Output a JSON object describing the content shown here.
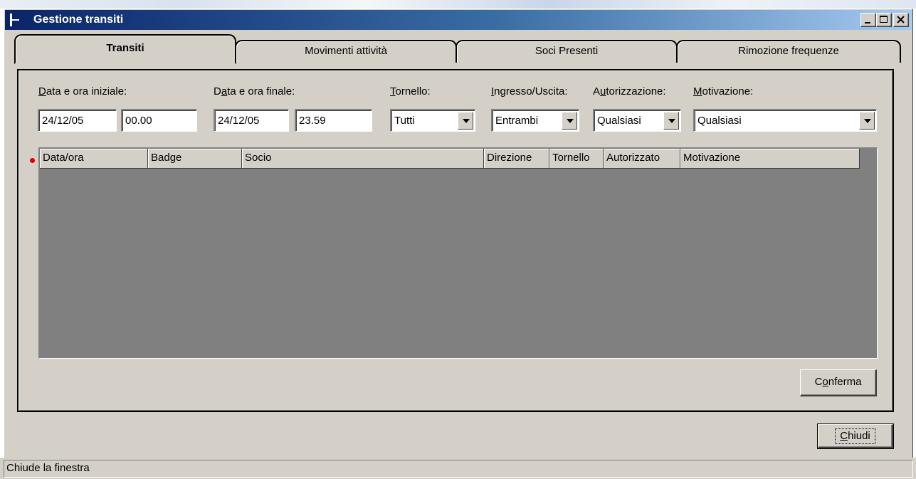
{
  "window": {
    "title": "Gestione transiti",
    "controls": {
      "minimize": "minimize-icon",
      "maximize": "maximize-icon",
      "close": "close-icon"
    }
  },
  "tabs": [
    {
      "label": "Transiti",
      "active": true
    },
    {
      "label": "Movimenti attività",
      "active": false
    },
    {
      "label": "Soci Presenti",
      "active": false
    },
    {
      "label": "Rimozione frequenze",
      "active": false
    }
  ],
  "filters": {
    "start": {
      "label_accel": "D",
      "label_rest": "ata e ora iniziale:",
      "date": "24/12/05",
      "time": "00.00"
    },
    "end": {
      "label_pre": "D",
      "label_accel": "a",
      "label_rest": "ta e ora finale:",
      "date": "24/12/05",
      "time": "23.59"
    },
    "turnstile": {
      "label_accel": "T",
      "label_rest": "ornello:",
      "value": "Tutti"
    },
    "direction": {
      "label_accel": "I",
      "label_rest": "ngresso/Uscita:",
      "value": "Entrambi"
    },
    "authorization": {
      "label_pre": "A",
      "label_accel": "u",
      "label_rest": "torizzazione:",
      "value": "Qualsiasi"
    },
    "reason": {
      "label_accel": "M",
      "label_rest": "otivazione:",
      "value": "Qualsiasi"
    }
  },
  "grid": {
    "columns": [
      "Data/ora",
      "Badge",
      "Socio",
      "Direzione",
      "Tornello",
      "Autorizzato",
      "Motivazione"
    ],
    "rows": []
  },
  "buttons": {
    "confirm": {
      "pre": "C",
      "accel": "o",
      "rest": "nferma"
    },
    "close": {
      "accel": "C",
      "rest": "hiudi"
    }
  },
  "status": {
    "text": "Chiude la finestra"
  },
  "colors": {
    "face": "#d4d0c8",
    "title_start": "#0a246a",
    "title_end": "#a6caf0",
    "grid_bg": "#808080",
    "marker": "#e00000"
  }
}
